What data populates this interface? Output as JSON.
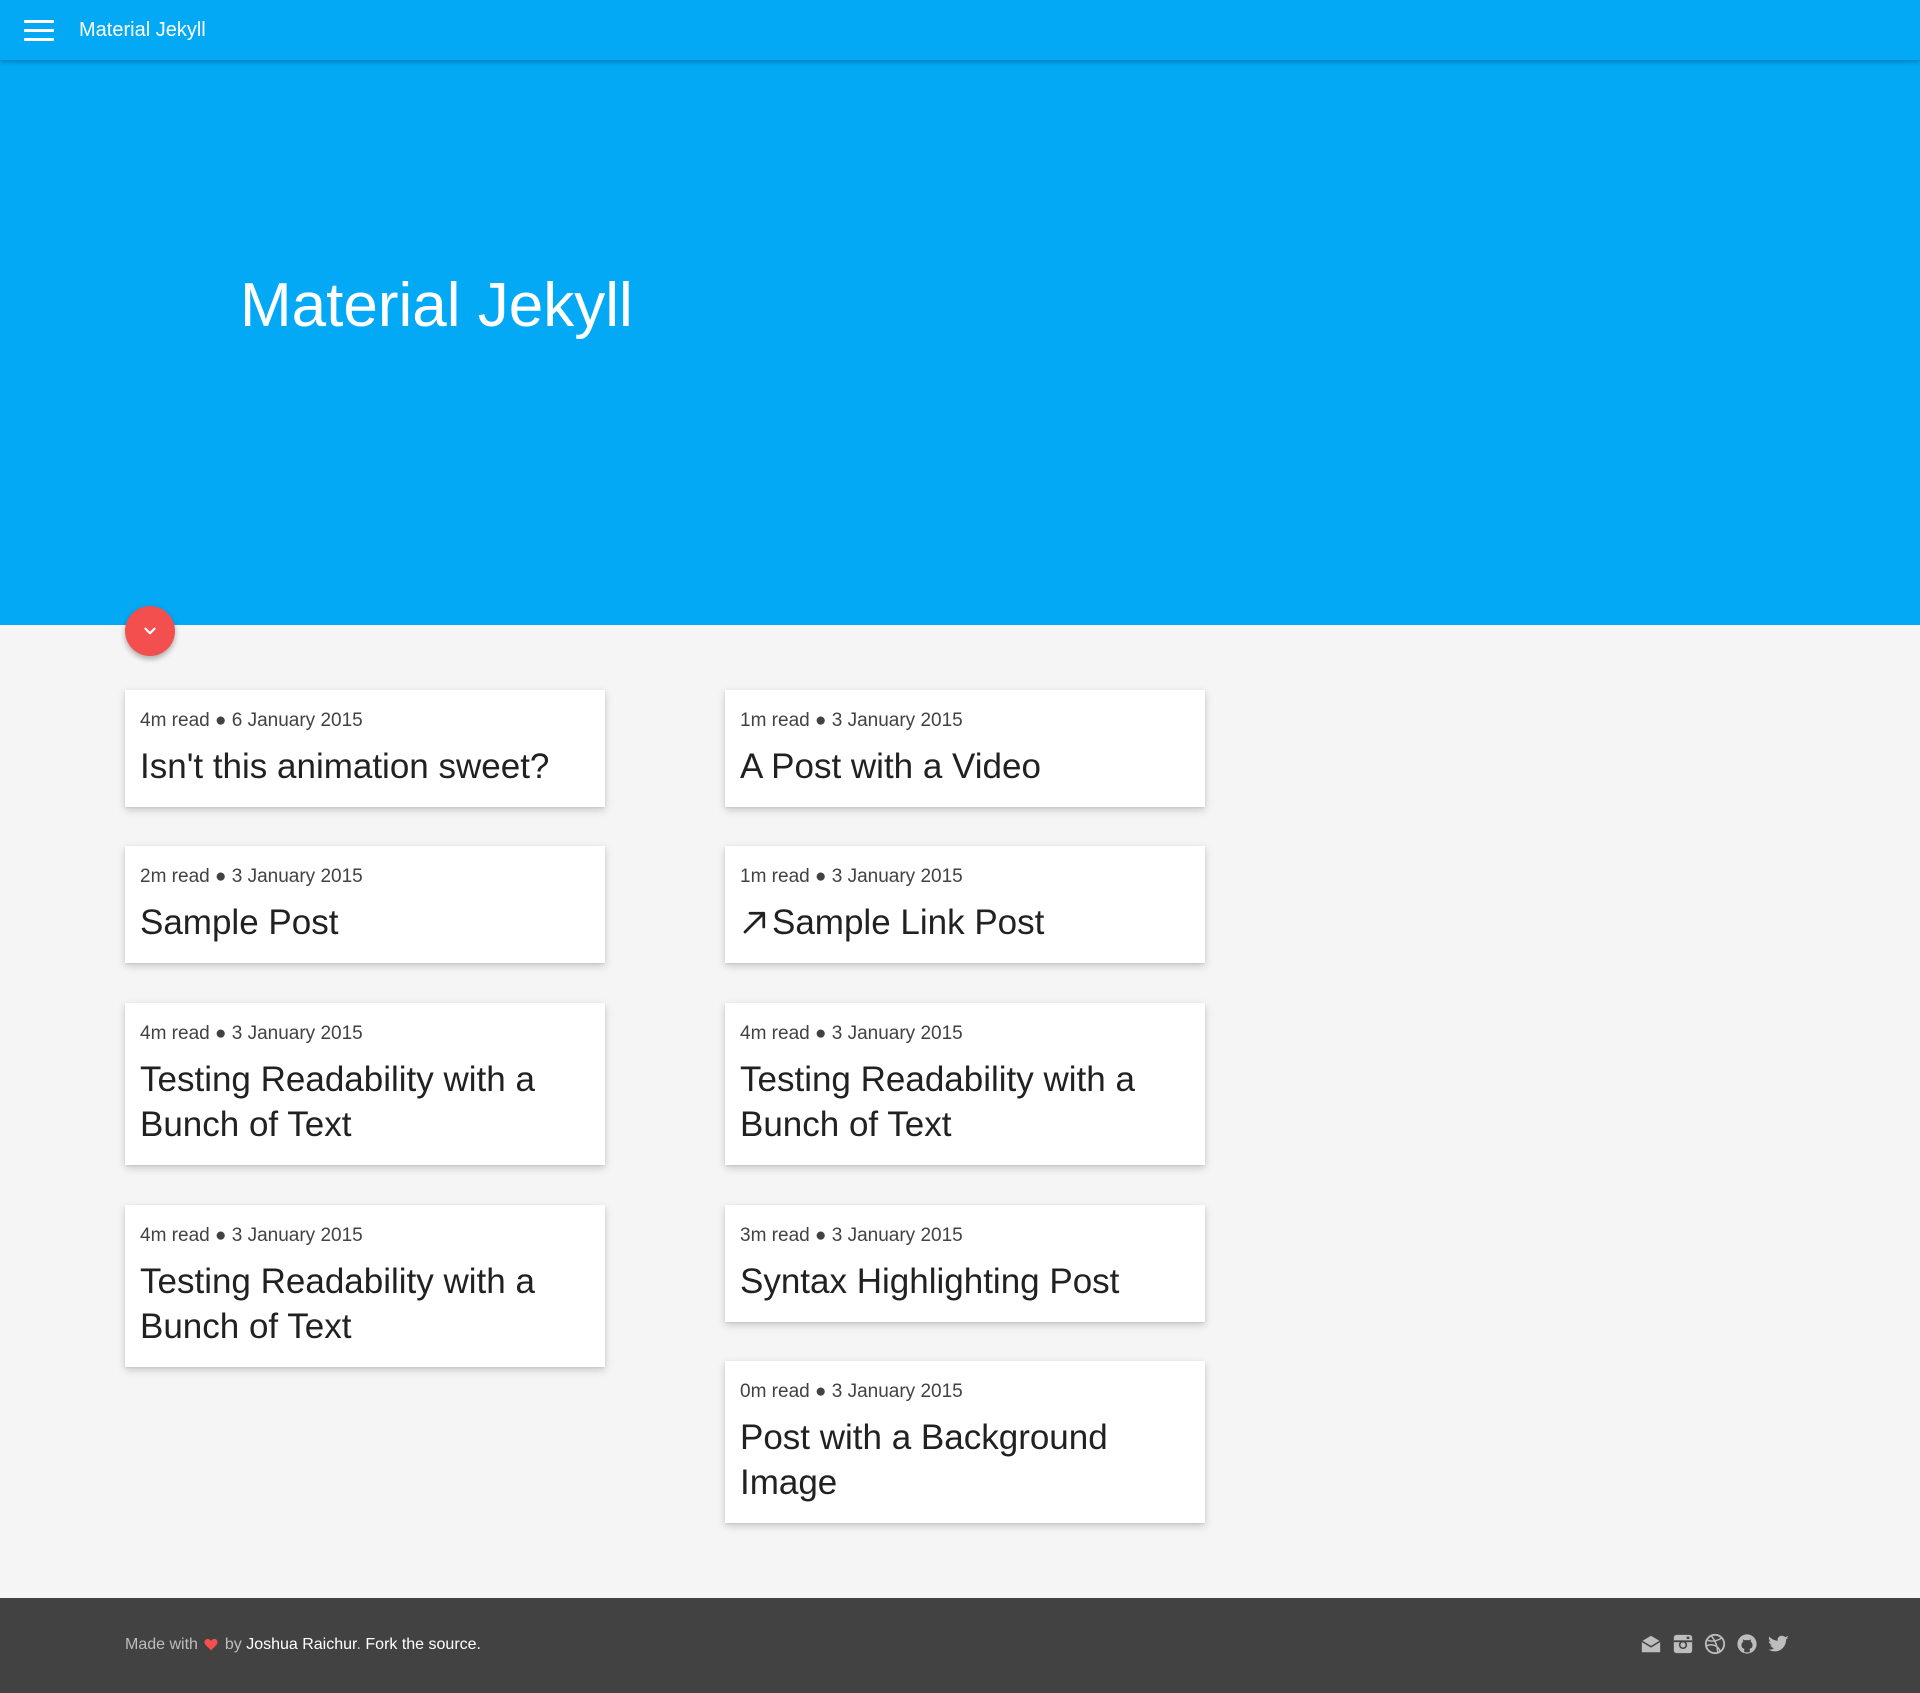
{
  "header": {
    "title": "Material Jekyll"
  },
  "hero": {
    "title": "Material Jekyll"
  },
  "posts": [
    {
      "meta": "4m read ● 6 January 2015",
      "title": "Isn't this animation sweet?"
    },
    {
      "meta": "1m read ● 3 January 2015",
      "title": "A Post with a Video"
    },
    {
      "meta": "2m read ● 3 January 2015",
      "title": "Sample Post"
    },
    {
      "meta": "1m read ● 3 January 2015",
      "title": "Sample Link Post"
    },
    {
      "meta": "4m read ● 3 January 2015",
      "title": "Testing Readability with a Bunch of Text"
    },
    {
      "meta": "4m read ● 3 January 2015",
      "title": "Testing Readability with a Bunch of Text"
    },
    {
      "meta": "4m read ● 3 January 2015",
      "title": "Testing Readability with a Bunch of Text"
    },
    {
      "meta": "3m read ● 3 January 2015",
      "title": "Syntax Highlighting Post"
    },
    {
      "meta": "0m read ● 3 January 2015",
      "title": "Post with a Background Image"
    }
  ],
  "footer": {
    "made_with": "Made with",
    "by": "by",
    "author": "Joshua Raichur",
    "period": ".",
    "fork": "Fork the source."
  },
  "icons": {
    "menu": "menu-icon",
    "fab": "chevron-down-icon",
    "link": "arrow-up-right-icon",
    "heart": "heart-icon",
    "social": [
      "mail-icon",
      "instagram-icon",
      "dribbble-icon",
      "github-icon",
      "twitter-icon"
    ]
  },
  "colors": {
    "primary": "#03a9f4",
    "accent": "#f44f4f",
    "background": "#f5f5f5",
    "footer": "#424242"
  }
}
